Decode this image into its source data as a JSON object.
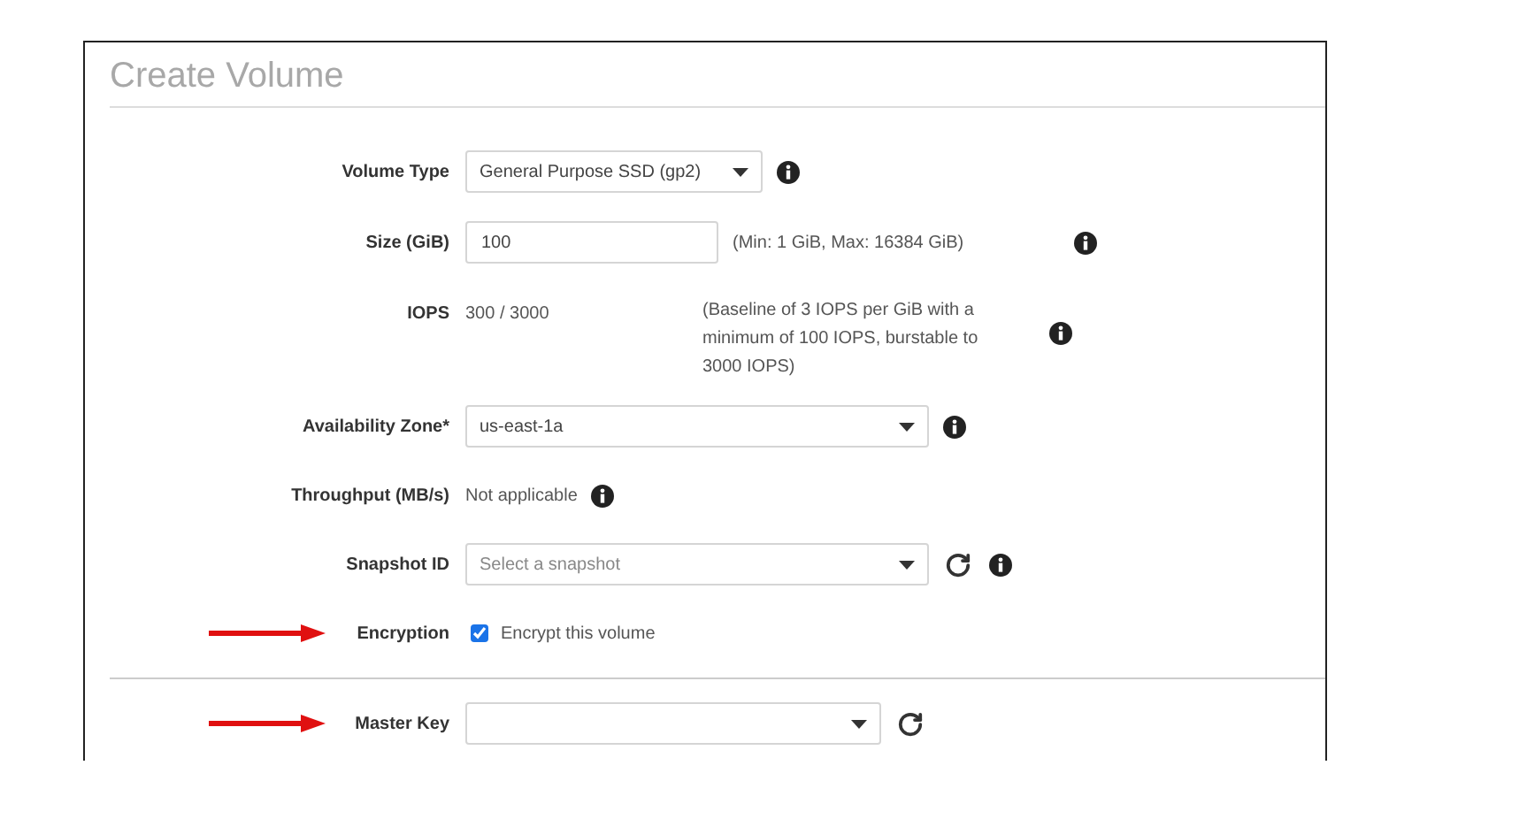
{
  "dialog": {
    "title": "Create Volume"
  },
  "sections": [
    {
      "rows": [
        {
          "kind": "select",
          "label": "Volume Type",
          "value": "General Purpose SSD (gp2)",
          "info": true,
          "refresh": false,
          "arrow": false
        },
        {
          "kind": "input",
          "label": "Size (GiB)",
          "value": "100",
          "hint": "(Min: 1 GiB, Max: 16384 GiB)",
          "info": true,
          "refresh": false,
          "arrow": false
        },
        {
          "kind": "note",
          "label": "IOPS",
          "value": "300 / 3000",
          "hint": "(Baseline of 3 IOPS per GiB with a minimum of 100 IOPS, burstable to 3000 IOPS)",
          "info": true,
          "refresh": false,
          "arrow": false
        },
        {
          "kind": "select",
          "label": "Availability Zone*",
          "value": "us-east-1a",
          "info": true,
          "refresh": false,
          "arrow": false
        },
        {
          "kind": "static",
          "label": "Throughput (MB/s)",
          "value": "Not applicable",
          "info": true,
          "refresh": false,
          "arrow": false
        },
        {
          "kind": "select",
          "label": "Snapshot ID",
          "placeholder": "Select a snapshot",
          "info": true,
          "refresh": true,
          "arrow": false
        },
        {
          "kind": "checkbox",
          "label": "Encryption",
          "value": "Encrypt this volume",
          "checked": true,
          "info": false,
          "refresh": false,
          "arrow": true
        }
      ]
    },
    {
      "rows": [
        {
          "kind": "select",
          "label": "Master Key",
          "info": false,
          "refresh": true,
          "arrow": true
        }
      ]
    }
  ]
}
